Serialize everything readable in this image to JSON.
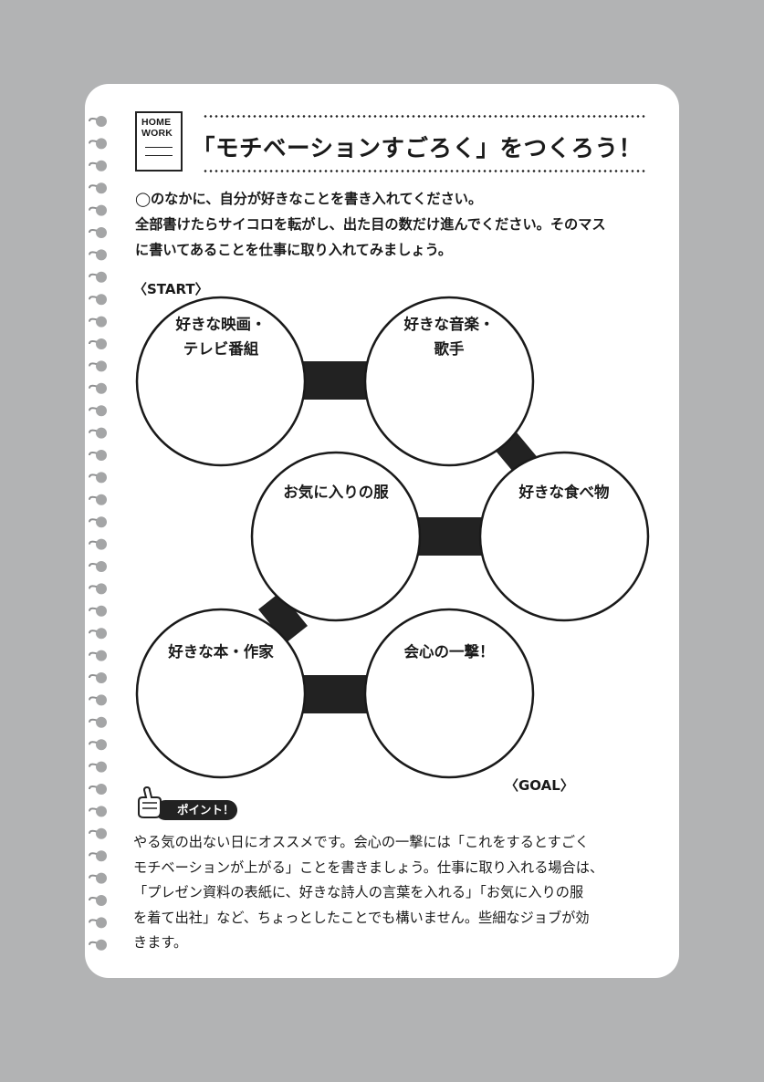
{
  "badge": {
    "line1": "HOME",
    "line2": "WORK"
  },
  "title": "「モチベーションすごろく」をつくろう！",
  "intro": [
    "◯のなかに、自分が好きなことを書き入れてください。",
    "全部書けたらサイコロを転がし、出た目の数だけ進んでください。そのマス",
    "に書いてあることを仕事に取り入れてみましょう。"
  ],
  "start_label": "〈START〉",
  "goal_label": "〈GOAL〉",
  "squares": [
    {
      "text": "好きな映画・\nテレビ番組"
    },
    {
      "text": "好きな音楽・\n歌手"
    },
    {
      "text": "好きな食べ物"
    },
    {
      "text": "お気に入りの服"
    },
    {
      "text": "好きな本・作家"
    },
    {
      "text": "会心の一撃！"
    }
  ],
  "point_label": "ポイント！",
  "point_text": [
    "やる気の出ない日にオススメです。会心の一撃には「これをするとすごく",
    "モチベーションが上がる」ことを書きましょう。仕事に取り入れる場合は、",
    "「プレゼン資料の表紙に、好きな詩人の言葉を入れる」「お気に入りの服",
    "を着て出社」など、ちょっとしたことでも構いません。些細なジョブが効",
    "きます。"
  ],
  "colors": {
    "background": "#b2b3b4",
    "card": "#ffffff",
    "ink": "#1a1a1a"
  }
}
